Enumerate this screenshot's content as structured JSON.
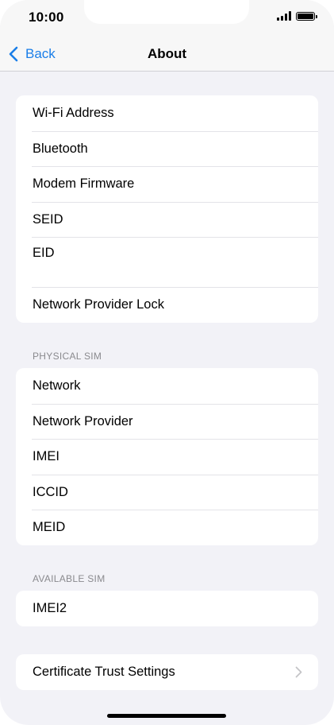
{
  "status_bar": {
    "time": "10:00"
  },
  "nav": {
    "back_label": "Back",
    "title": "About"
  },
  "group_main": [
    {
      "label": "Wi-Fi Address"
    },
    {
      "label": "Bluetooth"
    },
    {
      "label": "Modem Firmware"
    },
    {
      "label": "SEID"
    },
    {
      "label": "EID"
    },
    {
      "label": "Network Provider Lock"
    }
  ],
  "physical_sim": {
    "header": "PHYSICAL SIM",
    "items": [
      {
        "label": "Network"
      },
      {
        "label": "Network Provider"
      },
      {
        "label": "IMEI"
      },
      {
        "label": "ICCID"
      },
      {
        "label": "MEID"
      }
    ]
  },
  "available_sim": {
    "header": "AVAILABLE SIM",
    "items": [
      {
        "label": "IMEI2"
      }
    ]
  },
  "certificate": {
    "label": "Certificate Trust Settings"
  },
  "colors": {
    "accent": "#1a7ee8",
    "background": "#f2f2f7",
    "group_background": "#ffffff",
    "header_text": "#8a8a8e"
  },
  "icons": {
    "back": "chevron-left-icon",
    "disclosure": "chevron-right-icon",
    "signal": "cellular-signal-icon",
    "battery": "battery-icon"
  }
}
